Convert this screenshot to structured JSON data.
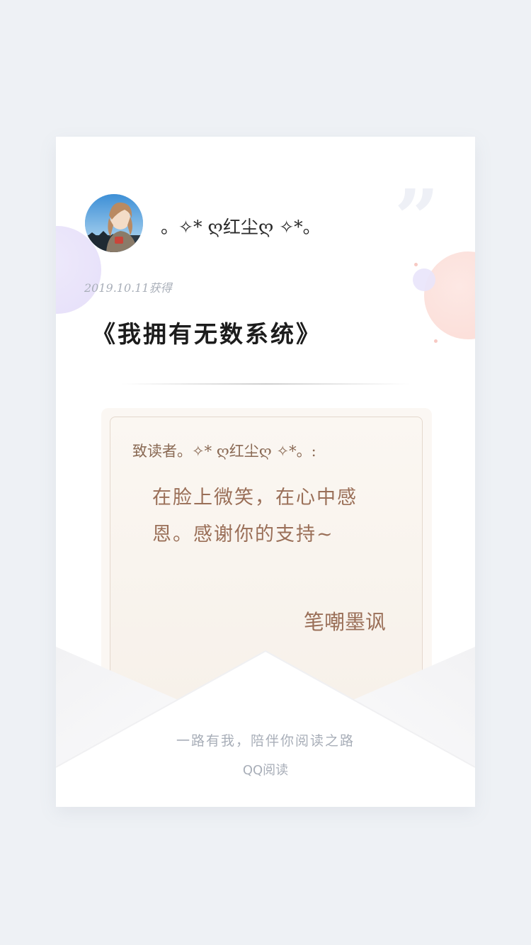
{
  "profile": {
    "username": "。✧* ღ红尘ღ ✧*。",
    "date_text": "2019.10.11获得"
  },
  "book": {
    "title": "《我拥有无数系统》"
  },
  "letter": {
    "salutation": "致读者。✧* ღ红尘ღ ✧*。:",
    "message": "在脸上微笑，在心中感恩。感谢你的支持~",
    "signature": "笔嘲墨讽"
  },
  "footer": {
    "tagline": "一路有我，陪伴你阅读之路",
    "brand": "QQ阅读"
  },
  "colors": {
    "background": "#eef1f5",
    "card": "#ffffff",
    "letter_text": "#9a6f58",
    "muted_text": "#a8aeb8"
  }
}
